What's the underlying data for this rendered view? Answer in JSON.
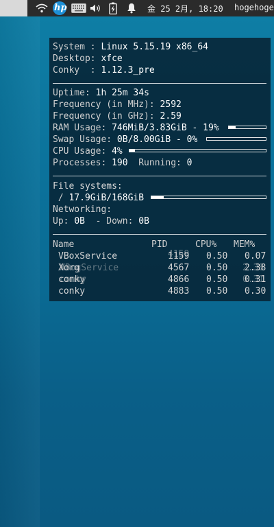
{
  "panel": {
    "icons": [
      "wifi-icon",
      "hp-logo-icon",
      "keyboard-icon",
      "volume-icon",
      "battery-charging-icon",
      "notification-bell-icon"
    ],
    "hp_text": "hp",
    "clock": "金 25  2月, 18:20",
    "user": "hogehoge"
  },
  "system": {
    "system_label": "System : ",
    "system_value": "Linux 5.15.19 x86_64",
    "desktop_label": "Desktop: ",
    "desktop_value": "xfce",
    "conky_label": "Conky  : ",
    "conky_value": "1.12.3_pre"
  },
  "stats": {
    "uptime_label": "Uptime: ",
    "uptime_value": "1h 25m 34s",
    "freq_mhz_label": "Frequency (in MHz): ",
    "freq_mhz_value": "2592",
    "freq_ghz_label": "Frequency (in GHz): ",
    "freq_ghz_value": "2.59",
    "ram_label": "RAM Usage: ",
    "ram_value": "746MiB/3.83GiB - 19%",
    "ram_percent": 19,
    "swap_label": "Swap Usage: ",
    "swap_value": "0B/8.00GiB - 0%",
    "swap_percent": 0,
    "cpu_label": "CPU Usage: ",
    "cpu_value": "4%",
    "cpu_percent": 4,
    "processes_label": "Processes: ",
    "processes_value": "190",
    "running_label": "  Running: ",
    "running_value": "0"
  },
  "fs": {
    "title": "File systems:",
    "root_label": " / ",
    "root_value": "17.9GiB/168GiB",
    "root_percent": 11,
    "net_title": "Networking:",
    "up_label": "Up: ",
    "up_value": "0B",
    "down_label": "  - Down: ",
    "down_value": "0B"
  },
  "processes": {
    "headers": [
      "Name",
      "PID",
      "CPU%",
      "MEM%"
    ],
    "rows": [
      {
        "name": "VBoxService",
        "pid": "1159",
        "cpu": "0.50",
        "mem": "0.07"
      },
      {
        "name": "Xorg",
        "pid": "4567",
        "cpu": "0.50",
        "mem": "2.38"
      },
      {
        "name": "conky",
        "pid": "4866",
        "cpu": "0.50",
        "mem": "0.31"
      },
      {
        "name": "conky",
        "pid": "4883",
        "cpu": "0.50",
        "mem": "0.30"
      }
    ],
    "ghost_rows": [
      {
        "name": "VBoxService",
        "pid": "4159",
        "cpu": "0.50",
        "mem": "0.07"
      },
      {
        "name": "Xorg",
        "pid": "4567",
        "cpu": "0.50",
        "mem": "2.38"
      },
      {
        "name": "conky",
        "pid": "4866",
        "cpu": "0.50",
        "mem": "0.31"
      }
    ]
  }
}
